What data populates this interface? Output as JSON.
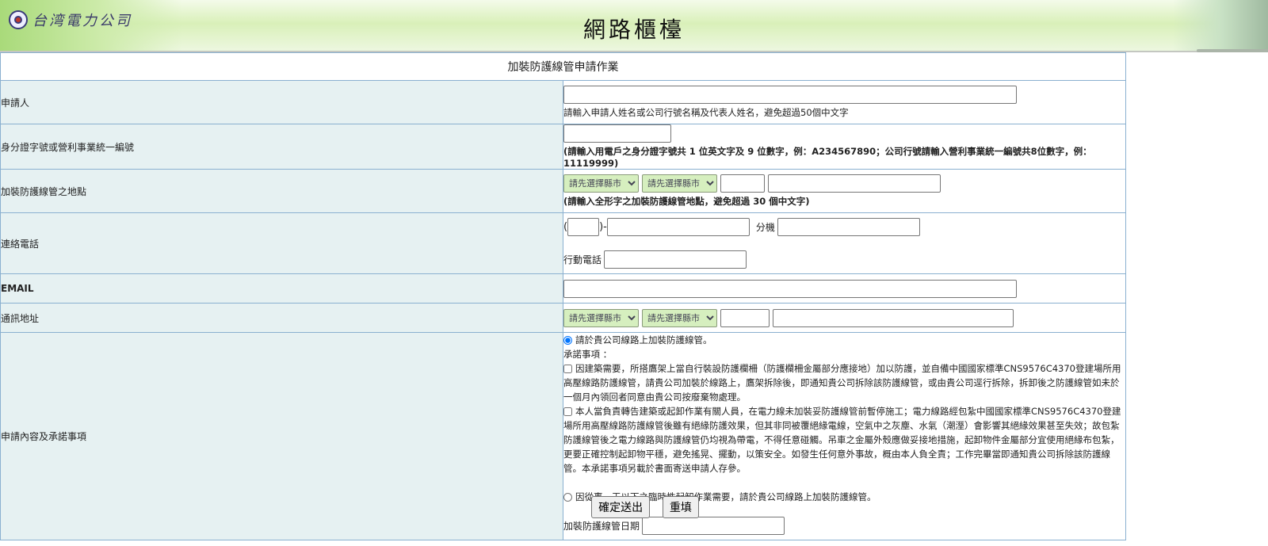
{
  "header": {
    "company_logo_text": "台湾電力公司",
    "site_title": "網路櫃檯"
  },
  "form": {
    "caption": "加裝防護線管申請作業",
    "applicant": {
      "label": "申請人",
      "value": "",
      "hint": "請輸入申請人姓名或公司行號名稱及代表人姓名，避免超過50個中文字"
    },
    "id_number": {
      "label": "身分證字號或營利事業統一編號",
      "value": "",
      "hint": "(請輸入用電戶之身分證字號共 1 位英文字及 9 位數字，例：A234567890；公司行號請輸入營利事業統一編號共8位數字，例：11119999)"
    },
    "location": {
      "label": "加裝防護線管之地點",
      "county_select": "請先選擇縣市",
      "district_select": "請先選擇縣市",
      "zip_value": "",
      "address_value": "",
      "hint": "(請輸入全形字之加裝防護線管地點，避免超過 30 個中文字)"
    },
    "phone": {
      "label": "連絡電話",
      "paren_open": "(",
      "paren_close": ")-",
      "area_code": "",
      "number": "",
      "ext_label": "分機",
      "ext": "",
      "mobile_label": "行動電話",
      "mobile": ""
    },
    "email": {
      "label": "EMAIL",
      "value": ""
    },
    "mailing_address": {
      "label": "通訊地址",
      "county_select": "請先選擇縣市",
      "district_select": "請先選擇縣市",
      "zip_value": "",
      "address_value": ""
    },
    "content": {
      "label": "申請內容及承諾事項",
      "option1": "請於貴公司線路上加裝防護線管。",
      "option1_selected": true,
      "commitments_title": "承諾事項 ：",
      "commitment1": "因建築需要，所搭鷹架上當自行裝設防護欄柵（防護欄柵金屬部分應接地）加以防護，並自備中國國家標準CNS9576C4370登建場所用高壓線路防護線管，請貴公司加裝於線路上，鷹架拆除後，即通知貴公司拆除該防護線管，或由貴公司逕行拆除，拆卸後之防護線管如未於一個月內領回者同意由貴公司按廢棄物處理。",
      "commitment1_checked": false,
      "commitment2": "本人當負責轉告建築或起卸作業有關人員，在電力線未加裝妥防護線管前暫停施工；電力線路經包紮中國國家標準CNS9576C4370登建場所用高壓線路防護線管後雖有絕緣防護效果，但其非同被覆絕緣電線，空氣中之灰塵、水氣（潮溼）會影響其絕緣效果甚至失效；故包紮防護線管後之電力線路與防護線管仍均視為帶電，不得任意碰觸。吊車之金屬外殼應做妥接地措施，起卸物件金屬部分宜使用絕緣布包紮，更要正確控制起卸物平穩，避免搖晃、擺動，以策安全。如發生任何意外事故，概由本人負全責；工作完畢當即通知貴公司拆除該防護線管。本承諾事項另載於書面寄送申請人存參。",
      "commitment2_checked": false,
      "option2": "因從事一天以下之臨時性起卸作業需要，請於貴公司線路上加裝防護線管。",
      "option2_selected": false,
      "date_label": "加裝防護線管日期",
      "date_value": ""
    }
  },
  "buttons": {
    "submit": "確定送出",
    "reset": "重填"
  }
}
